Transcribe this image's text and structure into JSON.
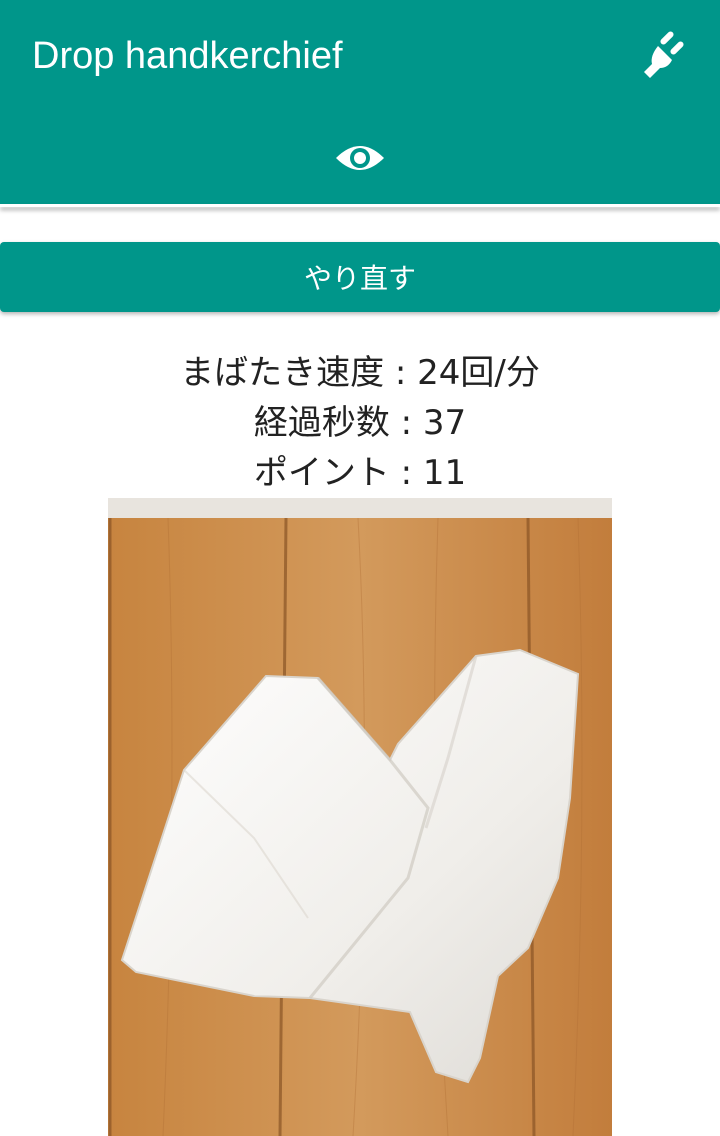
{
  "app_bar": {
    "title": "Drop handkerchief",
    "plug_icon": "power-plug-icon",
    "eye_icon": "eye-icon"
  },
  "retry_button": {
    "label": "やり直す"
  },
  "stats": {
    "blink_rate": "まばたき速度 : 24回/分",
    "elapsed_seconds": "経過秒数 : 37",
    "points": "ポイント : 11"
  },
  "photo": {
    "subject": "handkerchief-image"
  },
  "colors": {
    "primary": "#00968a",
    "text": "#222222",
    "on_primary": "#ffffff"
  }
}
